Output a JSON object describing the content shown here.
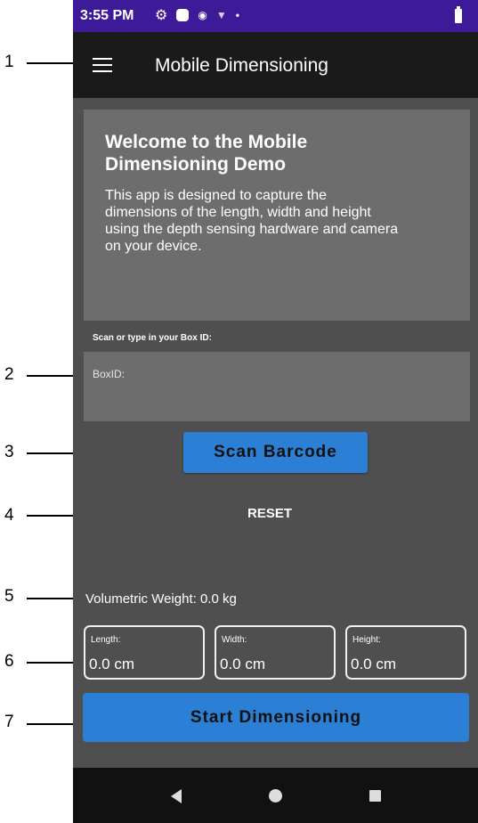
{
  "status_bar": {
    "time": "3:55 PM"
  },
  "app_bar": {
    "title": "Mobile Dimensioning"
  },
  "welcome": {
    "title": "Welcome to the Mobile Dimensioning Demo",
    "body": "This app is designed to capture the dimensions of the length, width and height using the depth sensing hardware and camera on your device."
  },
  "box_id": {
    "label": "Scan or type in your Box ID:",
    "placeholder": "BoxID:"
  },
  "scan_button": "Scan Barcode",
  "reset_button": "RESET",
  "volumetric_weight": "Volumetric Weight: 0.0 kg",
  "dimensions": [
    {
      "label": "Length:",
      "value": "0.0 cm"
    },
    {
      "label": "Width:",
      "value": "0.0 cm"
    },
    {
      "label": "Height:",
      "value": "0.0 cm"
    }
  ],
  "start_button": "Start Dimensioning",
  "callouts": [
    "1",
    "2",
    "3",
    "4",
    "5",
    "6",
    "7"
  ],
  "colors": {
    "status_bar": "#3d1a98",
    "app_bar": "#1a1a1a",
    "background": "#4f4f4f",
    "panel": "#6d6d6d",
    "accent": "#2b7fd4"
  }
}
